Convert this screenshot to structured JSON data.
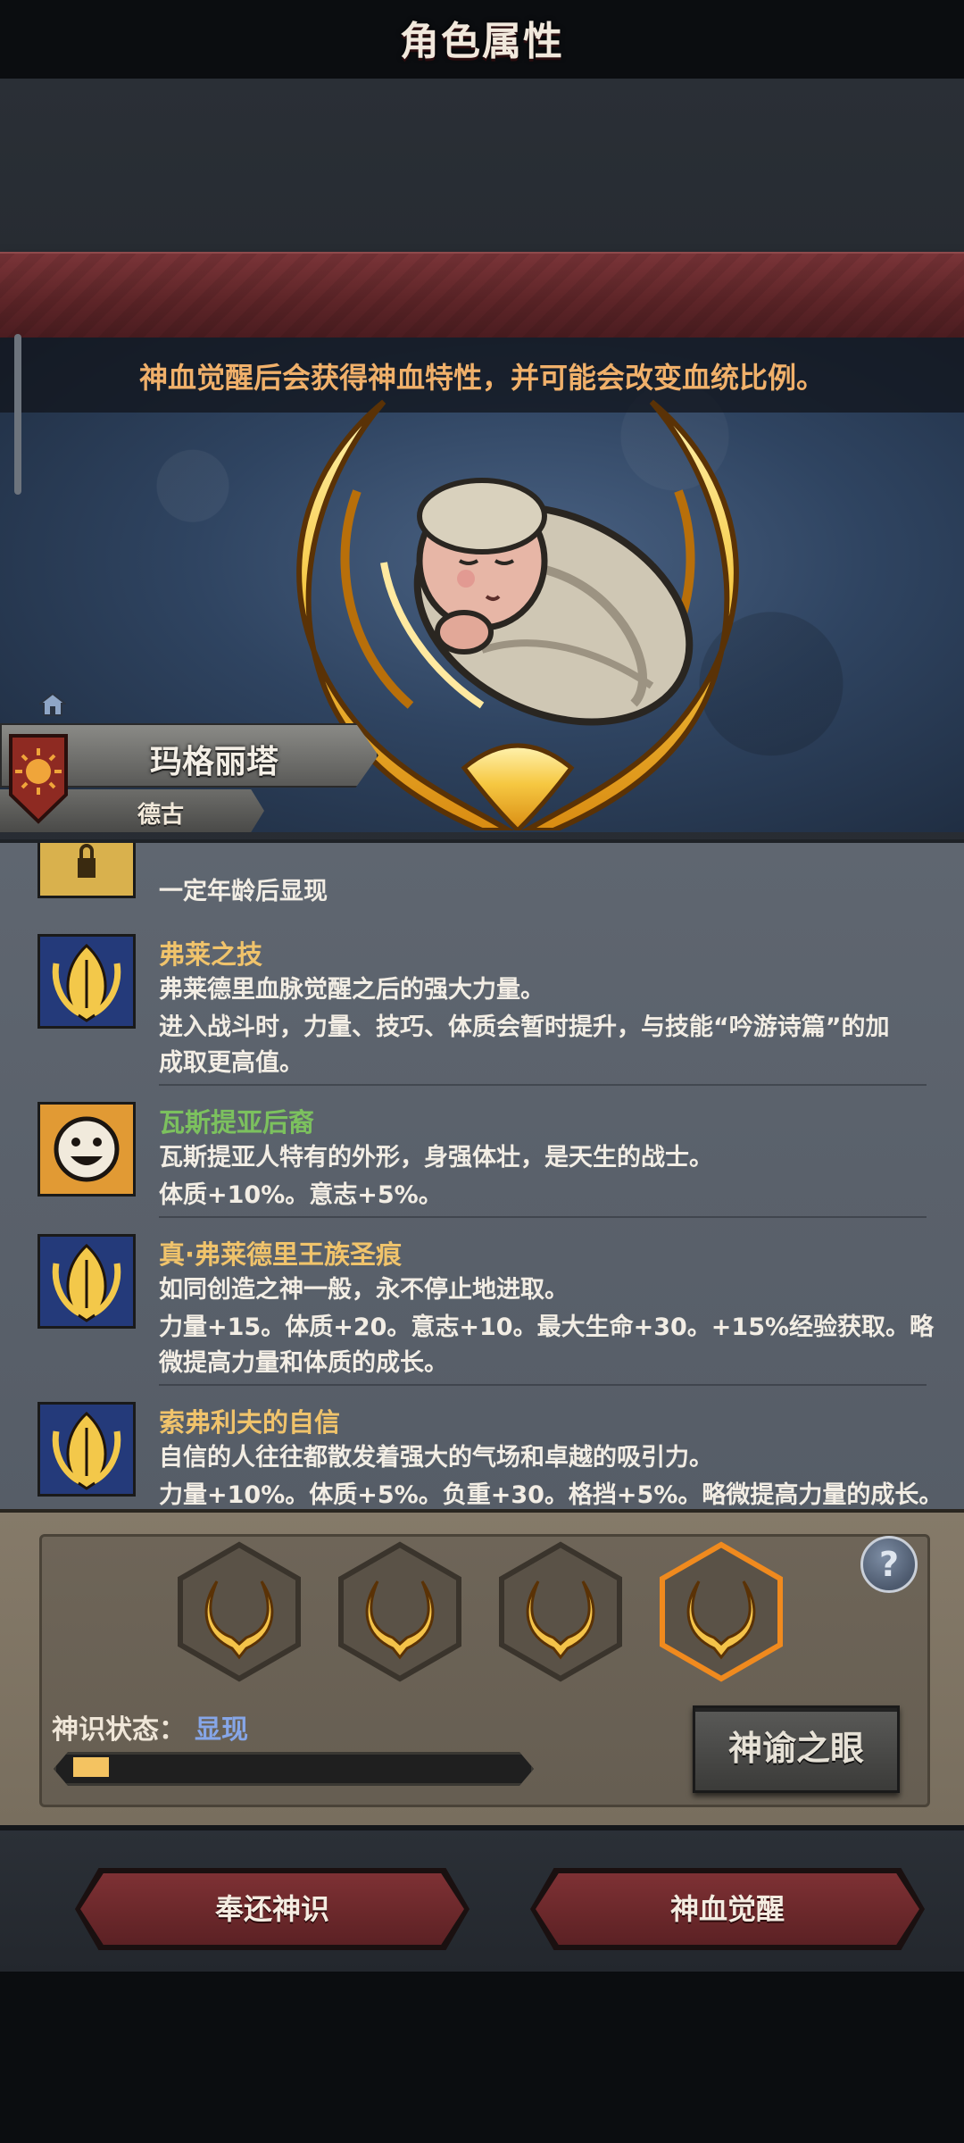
{
  "header": {
    "title": "角色属性"
  },
  "notice": "神血觉醒后会获得神血特性，并可能会改变血统比例。",
  "character": {
    "name": "玛格丽塔",
    "origin": "德古"
  },
  "traits": [
    {
      "title": "",
      "lines": [
        "一定年龄后显现"
      ],
      "icon": "lock-icon"
    },
    {
      "title": "弗莱之技",
      "title_color": "#f0c36b",
      "icon": "blood-crest-icon",
      "lines": [
        "弗莱德里血脉觉醒之后的强大力量。",
        "进入战斗时，力量、技巧、体质会暂时提升，与技能“吟游诗篇”的加",
        "成取更高值。"
      ]
    },
    {
      "title": "瓦斯提亚后裔",
      "title_color": "#7cc15e",
      "icon": "smiley-face-icon",
      "lines": [
        "瓦斯提亚人特有的外形，身强体壮，是天生的战士。",
        "体质+10%。意志+5%。"
      ]
    },
    {
      "title": "真·弗莱德里王族圣痕",
      "title_color": "#f0c36b",
      "icon": "blood-crest-icon",
      "lines": [
        "如同创造之神一般，永不停止地进取。",
        "力量+15。体质+20。意志+10。最大生命+30。+15%经验获取。略",
        "微提高力量和体质的成长。"
      ]
    },
    {
      "title": "索弗利夫的自信",
      "title_color": "#f0c36b",
      "icon": "blood-crest-icon",
      "lines": [
        "自信的人往往都散发着强大的气场和卓越的吸引力。",
        "力量+10%。体质+5%。负重+30。格挡+5%。略微提高力量的成长。"
      ]
    }
  ],
  "god_sense": {
    "state_label": "神识状态：",
    "state_value": "显现",
    "progress": 0.05,
    "slots": [
      "wing-emblem-icon",
      "wing-emblem-icon",
      "wing-emblem-icon",
      "wing-emblem-icon"
    ],
    "selected_slot": 3,
    "help": "?",
    "oracle_button": "神谕之眼"
  },
  "actions": {
    "return_label": "奉还神识",
    "awaken_label": "神血觉醒"
  }
}
